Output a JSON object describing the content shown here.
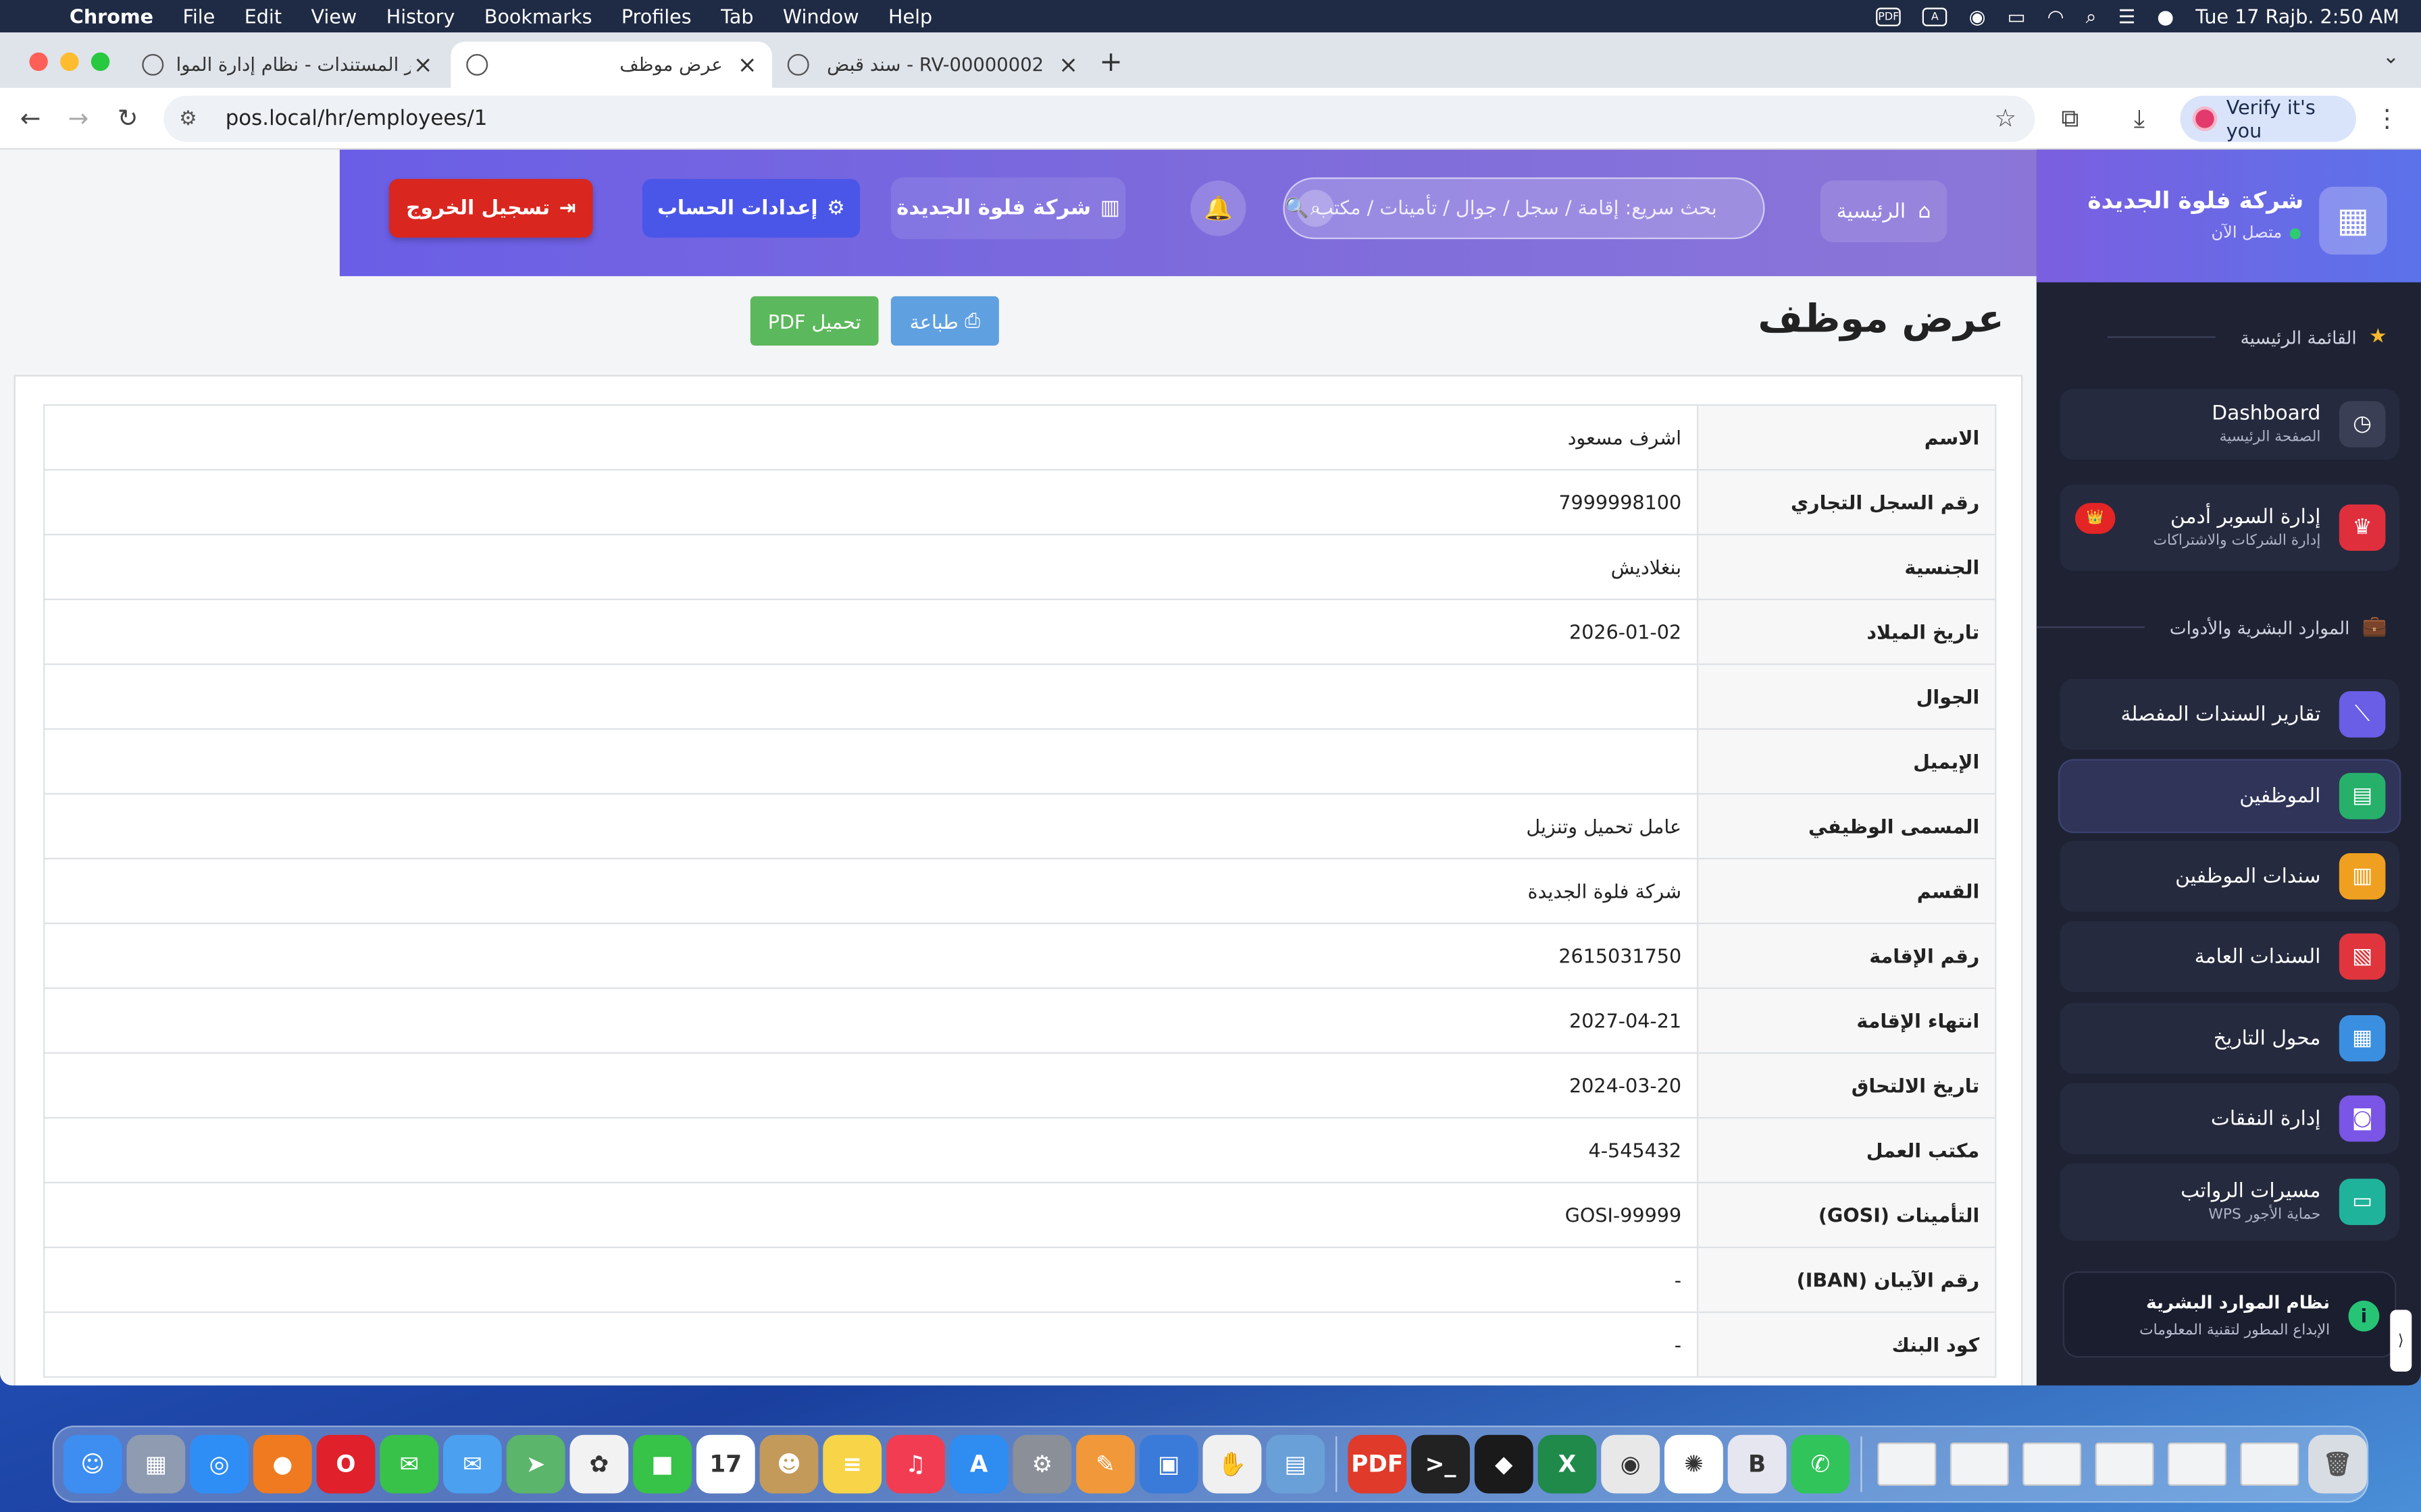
{
  "menubar": {
    "app": "Chrome",
    "items": [
      "File",
      "Edit",
      "View",
      "History",
      "Bookmarks",
      "Profiles",
      "Tab",
      "Window",
      "Help"
    ],
    "pdf_badge": "PDF",
    "input_badge": "A",
    "clock": "Tue 17 Rajb.  2:50 AM"
  },
  "browser": {
    "tabs": [
      {
        "title": "تقارير المستندات - نظام إدارة الموا",
        "active": false
      },
      {
        "title": "عرض موظف",
        "active": true
      },
      {
        "title": "سند قبض - RV-00000002",
        "active": false
      }
    ],
    "url": "pos.local/hr/employees/1",
    "verify_label": "Verify it's you"
  },
  "sidebar": {
    "brand": "شركة فلوة الجديدة",
    "status": "متصل الآن",
    "section_main": "القائمة الرئيسية",
    "section_hr": "الموارد البشرية والأدوات",
    "items": [
      {
        "label": "Dashboard",
        "sub": "الصفحة الرئيسية",
        "color": "#3a3f55",
        "icon": "gauge-icon"
      },
      {
        "label": "إدارة السوبر أدمن",
        "sub": "إدارة الشركات والاشتراكات",
        "color": "#e02f3c",
        "icon": "crown-icon",
        "badge": "👑"
      },
      {
        "label": "تقارير السندات المفصلة",
        "sub": "",
        "color": "#6a5ee6",
        "icon": "chart-icon"
      },
      {
        "label": "الموظفين",
        "sub": "",
        "color": "#27b06a",
        "icon": "id-card-icon",
        "active": true
      },
      {
        "label": "سندات الموظفين",
        "sub": "",
        "color": "#f0a020",
        "icon": "receipt-icon"
      },
      {
        "label": "السندات العامة",
        "sub": "",
        "color": "#e0353d",
        "icon": "document-icon"
      },
      {
        "label": "محول التاريخ",
        "sub": "",
        "color": "#3b8fe0",
        "icon": "calendar-icon"
      },
      {
        "label": "إدارة النفقات",
        "sub": "",
        "color": "#7a55e6",
        "icon": "money-icon"
      },
      {
        "label": "مسيرات الرواتب",
        "sub": "حماية الأجور WPS",
        "color": "#20b39b",
        "icon": "payroll-icon"
      }
    ],
    "footer_title": "نظام الموارد البشرية",
    "footer_sub": "الإبداع المطور لتقنية المعلومات"
  },
  "topbar": {
    "home_label": "الرئيسية",
    "search_placeholder": "بحث سريع: إقامة / سجل / جوال / تأمينات / مكتب 🔍",
    "company_label": "شركة فلوة الجديدة",
    "account_label": "إعدادات الحساب",
    "logout_label": "تسجيل الخروج"
  },
  "content": {
    "title": "عرض موظف",
    "print_label": "طباعة",
    "pdf_label": "تحميل PDF",
    "rows": [
      {
        "label": "الاسم",
        "value": "اشرف مسعود"
      },
      {
        "label": "رقم السجل التجاري",
        "value": "7999998100"
      },
      {
        "label": "الجنسية",
        "value": "بنغلاديش"
      },
      {
        "label": "تاريخ الميلاد",
        "value": "2026-01-02"
      },
      {
        "label": "الجوال",
        "value": ""
      },
      {
        "label": "الإيميل",
        "value": ""
      },
      {
        "label": "المسمى الوظيفي",
        "value": "عامل تحميل وتنزيل"
      },
      {
        "label": "القسم",
        "value": "شركة فلوة الجديدة"
      },
      {
        "label": "رقم الإقامة",
        "value": "2615031750"
      },
      {
        "label": "انتهاء الإقامة",
        "value": "2027-04-21"
      },
      {
        "label": "تاريخ الالتحاق",
        "value": "2024-03-20"
      },
      {
        "label": "مكتب العمل",
        "value": "4-545432"
      },
      {
        "label": "التأمينات (GOSI)",
        "value": "GOSI-99999"
      },
      {
        "label": "رقم الآيبان (IBAN)",
        "value": "-"
      },
      {
        "label": "كود البنك",
        "value": "-"
      }
    ]
  },
  "dock": {
    "apps": [
      {
        "name": "finder",
        "color": "#3d8ef0",
        "glyph": "☺"
      },
      {
        "name": "launchpad",
        "color": "#8e9bb0",
        "glyph": "▦"
      },
      {
        "name": "safari",
        "color": "#2f8ef5",
        "glyph": "◎"
      },
      {
        "name": "firefox",
        "color": "#f07a20",
        "glyph": "●"
      },
      {
        "name": "opera",
        "color": "#e0202a",
        "glyph": "O"
      },
      {
        "name": "messages",
        "color": "#39c24a",
        "glyph": "✉"
      },
      {
        "name": "mail",
        "color": "#4ba0f0",
        "glyph": "✉"
      },
      {
        "name": "maps",
        "color": "#5bb56a",
        "glyph": "➤"
      },
      {
        "name": "photos",
        "color": "#f2f2f2",
        "glyph": "✿"
      },
      {
        "name": "facetime",
        "color": "#37c248",
        "glyph": "■"
      },
      {
        "name": "calendar",
        "color": "#ffffff",
        "glyph": "17"
      },
      {
        "name": "contacts",
        "color": "#c49a5a",
        "glyph": "☻"
      },
      {
        "name": "notes",
        "color": "#f7d448",
        "glyph": "≡"
      },
      {
        "name": "music",
        "color": "#f23c52",
        "glyph": "♫"
      },
      {
        "name": "app-store",
        "color": "#2f8cf0",
        "glyph": "A"
      },
      {
        "name": "system-settings",
        "color": "#8a8f98",
        "glyph": "⚙"
      },
      {
        "name": "pages-like",
        "color": "#f0983a",
        "glyph": "✎"
      },
      {
        "name": "remote-desktop",
        "color": "#3a7ad8",
        "glyph": "▣"
      },
      {
        "name": "gesture-app",
        "color": "#f0f0f0",
        "glyph": "✋"
      },
      {
        "name": "preview",
        "color": "#6aa0d8",
        "glyph": "▤"
      },
      {
        "name": "pdf-app",
        "color": "#e03a2a",
        "glyph": "PDF"
      },
      {
        "name": "terminal",
        "color": "#222222",
        "glyph": ">_"
      },
      {
        "name": "vpn-app",
        "color": "#1a1a1a",
        "glyph": "◆"
      },
      {
        "name": "excel",
        "color": "#1f8a4a",
        "glyph": "X"
      },
      {
        "name": "chrome",
        "color": "#e8e8e8",
        "glyph": "◉"
      },
      {
        "name": "chatgpt",
        "color": "#ffffff",
        "glyph": "✺"
      },
      {
        "name": "bold-app",
        "color": "#e6e6f0",
        "glyph": "B"
      },
      {
        "name": "whatsapp",
        "color": "#30c45a",
        "glyph": "✆"
      }
    ],
    "windows": 6
  }
}
